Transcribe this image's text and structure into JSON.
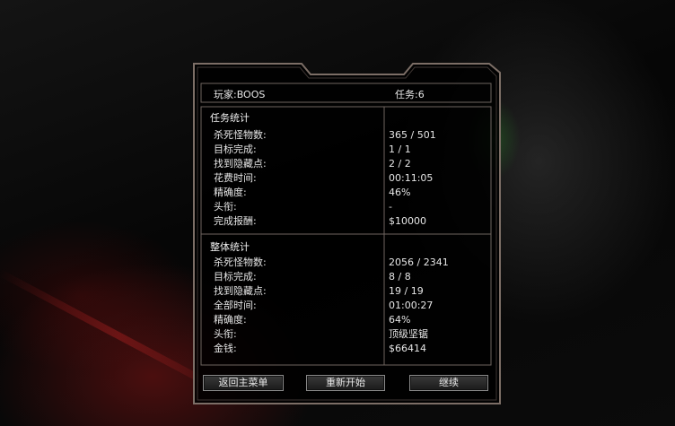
{
  "header": {
    "player_label": "玩家:BOOS",
    "mission_label": "任务:6"
  },
  "mission_stats": {
    "title": "任务统计",
    "rows": [
      {
        "label": "杀死怪物数:",
        "value": "365 / 501"
      },
      {
        "label": "目标完成:",
        "value": "1 / 1"
      },
      {
        "label": "找到隐藏点:",
        "value": "2 / 2"
      },
      {
        "label": "花费时间:",
        "value": "00:11:05"
      },
      {
        "label": "精确度:",
        "value": "46%"
      },
      {
        "label": "头衔:",
        "value": "-"
      },
      {
        "label": "完成报酬:",
        "value": "$10000"
      }
    ]
  },
  "overall_stats": {
    "title": "整体统计",
    "rows": [
      {
        "label": "杀死怪物数:",
        "value": "2056 / 2341"
      },
      {
        "label": "目标完成:",
        "value": "8 / 8"
      },
      {
        "label": "找到隐藏点:",
        "value": "19 / 19"
      },
      {
        "label": "全部时间:",
        "value": "01:00:27"
      },
      {
        "label": "精确度:",
        "value": "64%"
      },
      {
        "label": "头衔:",
        "value": "顶级坚锯"
      },
      {
        "label": "金钱:",
        "value": "$66414"
      }
    ]
  },
  "buttons": {
    "main_menu": "返回主菜单",
    "restart": "重新开始",
    "continue": "继续"
  }
}
